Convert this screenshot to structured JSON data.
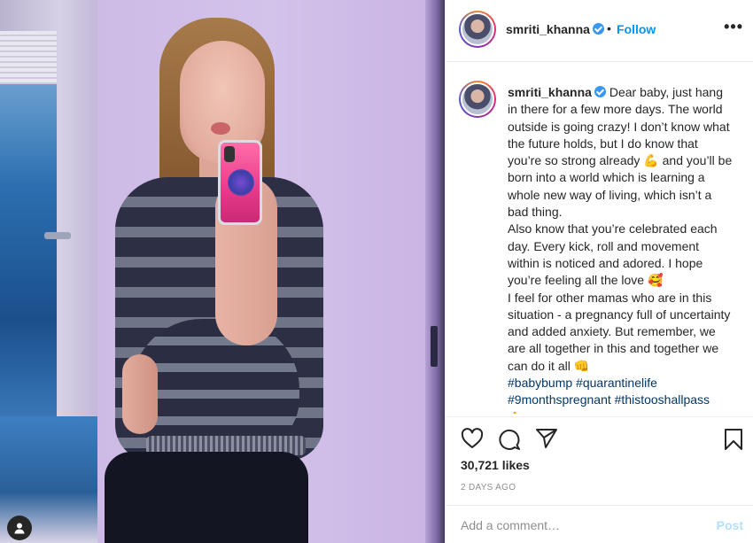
{
  "post": {
    "username": "smriti_khanna",
    "follow_label": "Follow",
    "separator": "•",
    "more_label": "•••",
    "caption": {
      "username": "smriti_khanna",
      "lines": [
        "Dear baby, just hang in there for a few more days. The world outside is going crazy! I don’t know what the future holds, but I do know that you’re so strong already 💪 and you’ll be born into a world which is learning a whole new way of living, which isn’t a bad thing.",
        "Also know that you’re celebrated each day. Every kick, roll and movement within is noticed and adored. I hope you’re feeling all the love 🥰",
        "I feel for other mamas who are in this situation - a pregnancy full of uncertainty and added anxiety. But remember, we are all together in this and together we can do it all 👊"
      ],
      "hashtags_line1": "#babybump #quarantinelife",
      "hashtags_line2": "#9monthspregnant #thistooshallpass",
      "trailing_emoji": "🙏"
    },
    "likes": "30,721 likes",
    "timestamp": "2 DAYS AGO",
    "comment_placeholder": "Add a comment…",
    "post_label": "Post"
  },
  "icons": {
    "like": "heart-icon",
    "comment": "comment-icon",
    "share": "share-icon",
    "save": "bookmark-icon",
    "verified": "verified-badge-icon",
    "photo_user": "user-tag-icon"
  },
  "colors": {
    "follow": "#0095f6",
    "verified": "#3897f0",
    "hashtag": "#00376b",
    "post_disabled": "#b2dffc",
    "muted": "#8e8e8e"
  }
}
